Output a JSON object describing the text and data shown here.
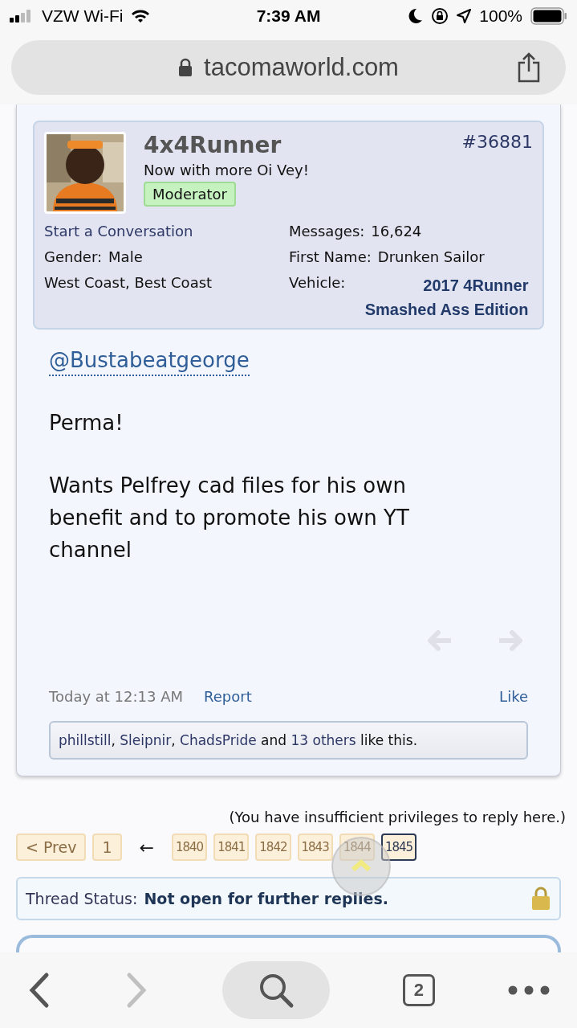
{
  "status_bar": {
    "carrier": "VZW Wi-Fi",
    "time": "7:39 AM",
    "battery": "100%"
  },
  "address_bar": {
    "url": "tacomaworld.com"
  },
  "post": {
    "avatar": {
      "kind": "picture"
    },
    "username": "4x4Runner",
    "post_number": "#36881",
    "user_title": "Now with more Oi Vey!",
    "badge": "Moderator",
    "left_info": [
      {
        "kind": "link",
        "text": "Start a Conversation"
      },
      {
        "kind": "pair",
        "label": "Gender:",
        "value": "Male"
      },
      {
        "kind": "plain",
        "text": "West Coast, Best Coast"
      }
    ],
    "right_info": [
      {
        "kind": "pair",
        "label": "Messages:",
        "value": "16,624"
      },
      {
        "kind": "pair",
        "label": "First Name:",
        "value": "Drunken Sailor"
      },
      {
        "kind": "link_pair",
        "label": "Vehicle:",
        "value": "2017 4Runner Smashed Ass Edition"
      }
    ],
    "mention": "@Bustabeatgeorge",
    "paragraphs": [
      "Perma!",
      "Wants Pelfrey cad files for his own benefit and to promote his own YT channel"
    ],
    "date": "Today at 12:13 AM",
    "report": "Report",
    "like": "Like",
    "likes": {
      "users": [
        "phillstill",
        "Sleipnir",
        "ChadsPride"
      ],
      "separator": ",",
      "and": "and",
      "others": "13 others",
      "tail": "like this."
    }
  },
  "privileges_note": "(You have insufficient privileges to reply here.)",
  "pagination": {
    "prev": "< Prev",
    "first": "1",
    "arrow": "←",
    "pages": [
      {
        "label": "1840",
        "selected": false
      },
      {
        "label": "1841",
        "selected": false
      },
      {
        "label": "1842",
        "selected": false
      },
      {
        "label": "1843",
        "selected": false
      },
      {
        "label": "1844",
        "selected": false
      },
      {
        "label": "1845",
        "selected": true
      }
    ]
  },
  "thread_status": {
    "label": "Thread Status:",
    "value": "Not open for further replies."
  },
  "toolbar": {
    "tabs_count": "2"
  }
}
